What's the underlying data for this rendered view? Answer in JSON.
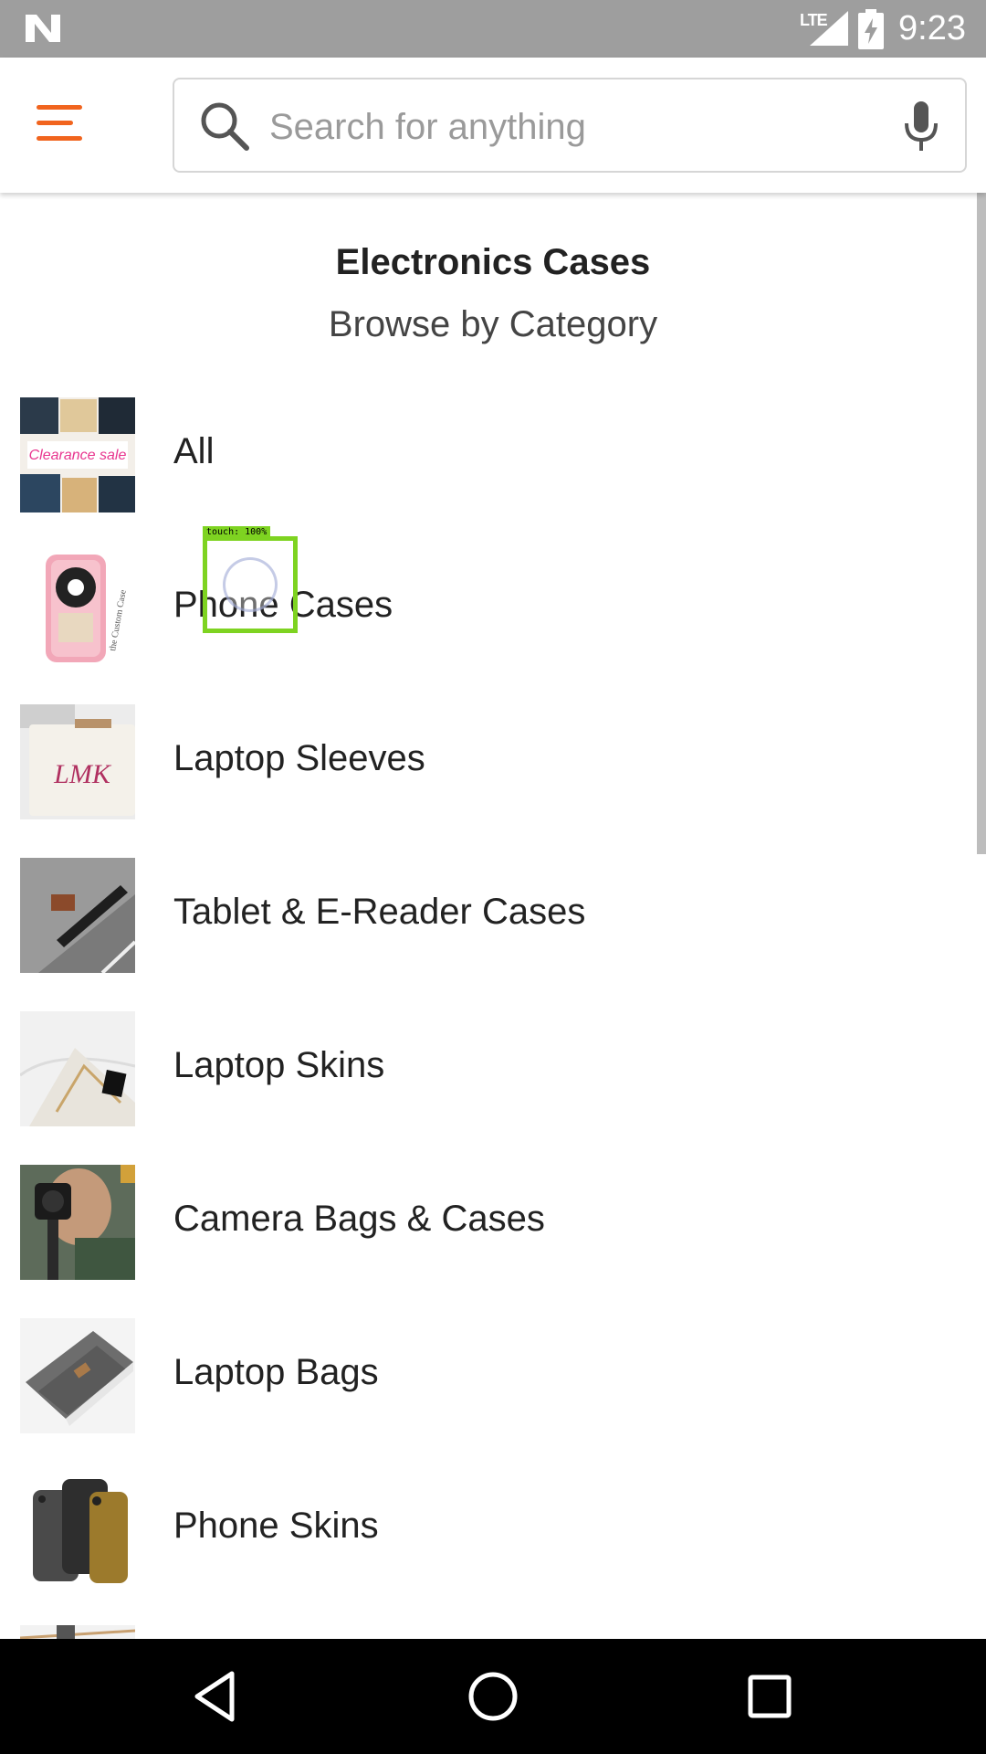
{
  "status_bar": {
    "network_label": "LTE",
    "time": "9:23"
  },
  "header": {
    "menu_icon": "hamburger-menu-icon",
    "search": {
      "placeholder": "Search for anything",
      "value": "",
      "search_icon": "search-icon",
      "mic_icon": "microphone-icon"
    }
  },
  "page": {
    "title": "Electronics Cases",
    "subtitle": "Browse by Category"
  },
  "categories": [
    {
      "label": "All"
    },
    {
      "label": "Phone Cases"
    },
    {
      "label": "Laptop Sleeves"
    },
    {
      "label": "Tablet & E-Reader Cases"
    },
    {
      "label": "Laptop Skins"
    },
    {
      "label": "Camera Bags & Cases"
    },
    {
      "label": "Laptop Bags"
    },
    {
      "label": "Phone Skins"
    }
  ],
  "touch_overlay": {
    "label": "touch: 100%"
  },
  "nav_bar": {
    "back_icon": "back-triangle-icon",
    "home_icon": "home-circle-icon",
    "recent_icon": "recent-apps-square-icon"
  },
  "colors": {
    "accent": "#f1641e",
    "status_bar": "#9e9e9e",
    "touch_highlight": "#7ed321"
  }
}
